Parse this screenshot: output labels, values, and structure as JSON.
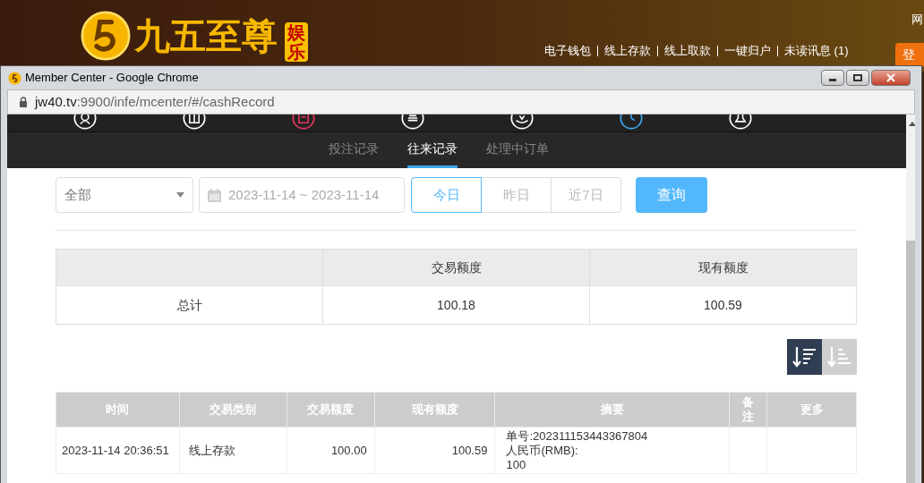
{
  "site": {
    "logo_text": "九五至尊",
    "logo_badge": "娱乐",
    "links": [
      "电子钱包",
      "线上存款",
      "线上取款",
      "一键归户",
      "未读讯息 (1)"
    ],
    "corner_text": "网",
    "login_button": "登"
  },
  "browser": {
    "title": "Member Center - Google Chrome",
    "url_host": "jw40.tv",
    "url_path": ":9900/infe/mcenter/#/cashRecord"
  },
  "nav_items": [
    {
      "selected": false,
      "highlighted": false
    },
    {
      "selected": false,
      "highlighted": false
    },
    {
      "selected": false,
      "highlighted": true
    },
    {
      "selected": false,
      "highlighted": false
    },
    {
      "selected": false,
      "highlighted": false
    },
    {
      "selected": true,
      "highlighted": false
    },
    {
      "selected": false,
      "highlighted": false
    }
  ],
  "subtabs": [
    {
      "label": "投注记录",
      "selected": false
    },
    {
      "label": "往来记录",
      "selected": true
    },
    {
      "label": "处理中订单",
      "selected": false
    }
  ],
  "filters": {
    "type_select": "全部",
    "date_range": "2023-11-14 ~ 2023-11-14",
    "quick_ranges": [
      {
        "label": "今日",
        "selected": true
      },
      {
        "label": "昨日",
        "selected": false
      },
      {
        "label": "近7日",
        "selected": false
      }
    ],
    "search_button": "查询"
  },
  "summary": {
    "columns": [
      "交易额度",
      "现有额度"
    ],
    "row_label": "总计",
    "values": [
      "100.18",
      "100.59"
    ]
  },
  "sort_buttons": [
    {
      "selected": true
    },
    {
      "selected": false
    }
  ],
  "records": {
    "columns": [
      "时间",
      "交易类别",
      "交易额度",
      "现有额度",
      "摘要",
      "备注",
      "更多"
    ],
    "rows": [
      {
        "time": "2023-11-14 20:36:51",
        "type": "线上存款",
        "amount": "100.00",
        "balance": "100.59",
        "summary": [
          "单号:202311153443367804",
          "人民币(RMB):",
          "100"
        ]
      }
    ]
  }
}
